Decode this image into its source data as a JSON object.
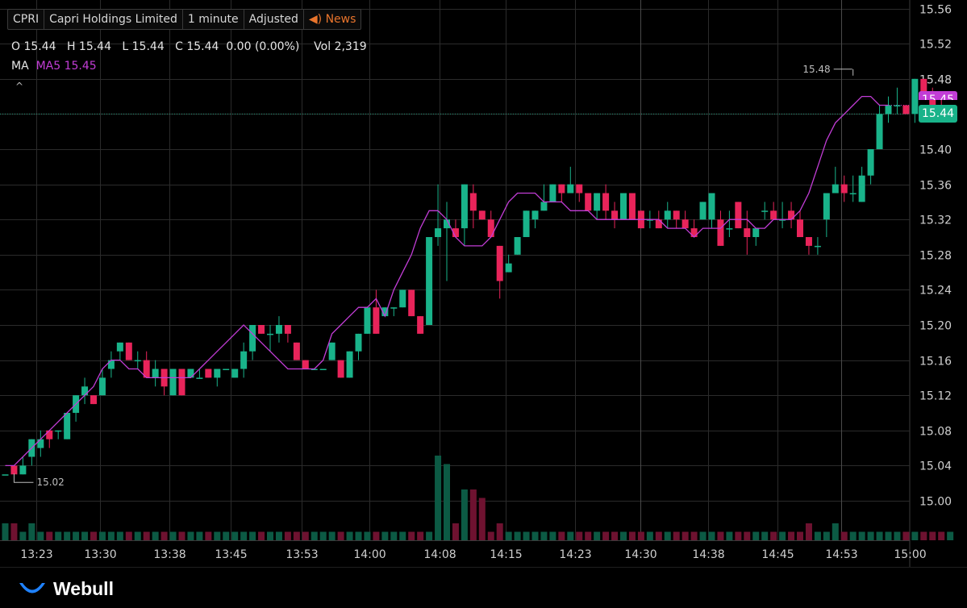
{
  "header": {
    "symbol": "CPRI",
    "company": "Capri Holdings Limited",
    "interval": "1 minute",
    "adjust": "Adjusted",
    "news": "News",
    "news_icon": "speaker-icon"
  },
  "ohlc": {
    "o_label": "O",
    "o": "15.44",
    "h_label": "H",
    "h": "15.44",
    "l_label": "L",
    "l": "15.44",
    "c_label": "C",
    "c": "15.44",
    "change": "0.00 (0.00%)",
    "vol_label": "Vol",
    "vol": "2,319"
  },
  "ma": {
    "label": "MA",
    "value": "MA5 15.45",
    "color": "#c23dd6"
  },
  "collapse_icon": "chevron-up-icon",
  "brand": {
    "name": "Webull",
    "icon": "webull-logo-icon"
  },
  "colors": {
    "up": "#19b38a",
    "down": "#e8245a",
    "ma": "#c23dd6",
    "background": "#000000",
    "grid": "#2b2b2b"
  },
  "last_price": {
    "value": "15.44",
    "ma_value": "15.45"
  },
  "chart_data": {
    "type": "candlestick",
    "ylim": [
      14.98,
      15.57
    ],
    "y_ticks": [
      "15.56",
      "15.52",
      "15.48",
      "15.44",
      "15.40",
      "15.36",
      "15.32",
      "15.28",
      "15.24",
      "15.20",
      "15.16",
      "15.12",
      "15.08",
      "15.04",
      "15.00"
    ],
    "x_tick_labels": [
      "13:23",
      "13:30",
      "13:38",
      "13:45",
      "13:53",
      "14:00",
      "14:08",
      "14:15",
      "14:23",
      "14:30",
      "14:38",
      "14:45",
      "14:53",
      "15:00"
    ],
    "x_tick_index": [
      3.5,
      10.7,
      18.6,
      25.5,
      33.6,
      41.2,
      49.2,
      56.7,
      64.5,
      71.9,
      79.6,
      87.4,
      94.7,
      102.4
    ],
    "annotations": {
      "high": "15.48",
      "low": "15.02"
    },
    "series": [
      {
        "name": "MA5",
        "values": [
          15.04,
          15.04,
          15.05,
          15.06,
          15.07,
          15.08,
          15.09,
          15.1,
          15.11,
          15.12,
          15.13,
          15.15,
          15.16,
          15.16,
          15.15,
          15.15,
          15.14,
          15.14,
          15.14,
          15.14,
          15.14,
          15.14,
          15.15,
          15.16,
          15.17,
          15.18,
          15.19,
          15.2,
          15.19,
          15.18,
          15.17,
          15.16,
          15.15,
          15.15,
          15.15,
          15.15,
          15.16,
          15.19,
          15.2,
          15.21,
          15.22,
          15.22,
          15.23,
          15.21,
          15.24,
          15.26,
          15.28,
          15.31,
          15.33,
          15.33,
          15.32,
          15.3,
          15.29,
          15.29,
          15.29,
          15.3,
          15.32,
          15.34,
          15.35,
          15.35,
          15.35,
          15.34,
          15.34,
          15.34,
          15.33,
          15.33,
          15.33,
          15.32,
          15.32,
          15.32,
          15.32,
          15.32,
          15.32,
          15.32,
          15.32,
          15.31,
          15.31,
          15.31,
          15.3,
          15.31,
          15.31,
          15.31,
          15.32,
          15.32,
          15.32,
          15.31,
          15.31,
          15.32,
          15.32,
          15.32,
          15.33,
          15.35,
          15.38,
          15.41,
          15.43,
          15.44,
          15.45,
          15.46,
          15.46,
          15.45,
          15.45
        ]
      }
    ],
    "candles": [
      [
        15.03,
        15.03,
        15.03,
        15.03,
        2
      ],
      [
        15.04,
        15.04,
        15.03,
        15.03,
        2
      ],
      [
        15.03,
        15.05,
        15.03,
        15.04,
        1
      ],
      [
        15.05,
        15.07,
        15.04,
        15.07,
        2
      ],
      [
        15.06,
        15.08,
        15.05,
        15.07,
        1
      ],
      [
        15.08,
        15.08,
        15.06,
        15.07,
        1
      ],
      [
        15.08,
        15.08,
        15.07,
        15.08,
        1
      ],
      [
        15.07,
        15.1,
        15.07,
        15.1,
        1
      ],
      [
        15.1,
        15.12,
        15.09,
        15.12,
        1
      ],
      [
        15.12,
        15.14,
        15.11,
        15.13,
        1
      ],
      [
        15.12,
        15.12,
        15.11,
        15.11,
        1
      ],
      [
        15.12,
        15.15,
        15.12,
        15.14,
        1
      ],
      [
        15.15,
        15.17,
        15.14,
        15.16,
        1
      ],
      [
        15.17,
        15.18,
        15.16,
        15.18,
        1
      ],
      [
        15.18,
        15.18,
        15.16,
        15.16,
        1
      ],
      [
        15.16,
        15.17,
        15.15,
        15.16,
        1
      ],
      [
        15.16,
        15.17,
        15.14,
        15.14,
        1
      ],
      [
        15.14,
        15.16,
        15.13,
        15.15,
        1
      ],
      [
        15.15,
        15.15,
        15.12,
        15.13,
        1
      ],
      [
        15.12,
        15.15,
        15.12,
        15.15,
        1
      ],
      [
        15.15,
        15.15,
        15.12,
        15.12,
        1
      ],
      [
        15.14,
        15.15,
        15.14,
        15.15,
        1
      ],
      [
        15.14,
        15.15,
        15.14,
        15.14,
        1
      ],
      [
        15.15,
        15.15,
        15.14,
        15.14,
        1
      ],
      [
        15.14,
        15.15,
        15.13,
        15.15,
        1
      ],
      [
        15.15,
        15.15,
        15.15,
        15.15,
        1
      ],
      [
        15.14,
        15.15,
        15.14,
        15.15,
        1
      ],
      [
        15.15,
        15.18,
        15.14,
        15.17,
        1
      ],
      [
        15.17,
        15.2,
        15.16,
        15.2,
        1
      ],
      [
        15.2,
        15.2,
        15.19,
        15.19,
        1
      ],
      [
        15.19,
        15.2,
        15.17,
        15.19,
        1
      ],
      [
        15.19,
        15.21,
        15.18,
        15.2,
        1
      ],
      [
        15.2,
        15.2,
        15.18,
        15.19,
        1
      ],
      [
        15.18,
        15.18,
        15.16,
        15.16,
        1
      ],
      [
        15.16,
        15.16,
        15.15,
        15.15,
        1
      ],
      [
        15.15,
        15.15,
        15.15,
        15.15,
        1
      ],
      [
        15.15,
        15.15,
        15.15,
        15.15,
        1
      ],
      [
        15.16,
        15.18,
        15.16,
        15.18,
        1
      ],
      [
        15.16,
        15.16,
        15.14,
        15.14,
        1
      ],
      [
        15.14,
        15.17,
        15.14,
        15.17,
        1
      ],
      [
        15.17,
        15.19,
        15.16,
        15.19,
        1
      ],
      [
        15.19,
        15.22,
        15.19,
        15.22,
        1
      ],
      [
        15.22,
        15.24,
        15.19,
        15.19,
        1
      ],
      [
        15.21,
        15.22,
        15.21,
        15.22,
        1
      ],
      [
        15.22,
        15.22,
        15.21,
        15.22,
        1
      ],
      [
        15.22,
        15.24,
        15.22,
        15.24,
        1
      ],
      [
        15.24,
        15.24,
        15.21,
        15.21,
        1
      ],
      [
        15.21,
        15.21,
        15.19,
        15.19,
        1
      ],
      [
        15.2,
        15.3,
        15.2,
        15.3,
        1
      ],
      [
        15.3,
        15.36,
        15.29,
        15.31,
        10
      ],
      [
        15.31,
        15.34,
        15.25,
        15.32,
        9
      ],
      [
        15.31,
        15.32,
        15.3,
        15.3,
        2
      ],
      [
        15.31,
        15.36,
        15.29,
        15.36,
        6
      ],
      [
        15.35,
        15.36,
        15.31,
        15.33,
        6
      ],
      [
        15.33,
        15.33,
        15.32,
        15.32,
        5
      ],
      [
        15.32,
        15.33,
        15.3,
        15.3,
        1
      ],
      [
        15.29,
        15.29,
        15.23,
        15.25,
        2
      ],
      [
        15.26,
        15.28,
        15.26,
        15.27,
        1
      ],
      [
        15.28,
        15.3,
        15.28,
        15.3,
        1
      ],
      [
        15.3,
        15.33,
        15.3,
        15.33,
        1
      ],
      [
        15.32,
        15.33,
        15.31,
        15.33,
        1
      ],
      [
        15.33,
        15.36,
        15.33,
        15.34,
        1
      ],
      [
        15.34,
        15.36,
        15.34,
        15.36,
        1
      ],
      [
        15.36,
        15.36,
        15.34,
        15.35,
        1
      ],
      [
        15.35,
        15.38,
        15.35,
        15.36,
        1
      ],
      [
        15.36,
        15.36,
        15.34,
        15.35,
        1
      ],
      [
        15.35,
        15.35,
        15.33,
        15.33,
        1
      ],
      [
        15.33,
        15.35,
        15.32,
        15.35,
        1
      ],
      [
        15.35,
        15.36,
        15.32,
        15.33,
        1
      ],
      [
        15.33,
        15.34,
        15.31,
        15.32,
        1
      ],
      [
        15.32,
        15.35,
        15.32,
        15.35,
        1
      ],
      [
        15.35,
        15.35,
        15.32,
        15.32,
        1
      ],
      [
        15.33,
        15.33,
        15.31,
        15.31,
        1
      ],
      [
        15.32,
        15.33,
        15.31,
        15.32,
        1
      ],
      [
        15.32,
        15.33,
        15.31,
        15.31,
        1
      ],
      [
        15.32,
        15.34,
        15.31,
        15.33,
        1
      ],
      [
        15.33,
        15.33,
        15.31,
        15.32,
        1
      ],
      [
        15.32,
        15.33,
        15.31,
        15.31,
        1
      ],
      [
        15.31,
        15.32,
        15.3,
        15.3,
        1
      ],
      [
        15.32,
        15.34,
        15.32,
        15.34,
        1
      ],
      [
        15.32,
        15.35,
        15.31,
        15.35,
        1
      ],
      [
        15.32,
        15.33,
        15.29,
        15.29,
        1
      ],
      [
        15.31,
        15.33,
        15.3,
        15.31,
        1
      ],
      [
        15.34,
        15.34,
        15.31,
        15.31,
        1
      ],
      [
        15.31,
        15.33,
        15.28,
        15.3,
        1
      ],
      [
        15.3,
        15.31,
        15.29,
        15.31,
        1
      ],
      [
        15.33,
        15.34,
        15.32,
        15.33,
        1
      ],
      [
        15.33,
        15.34,
        15.32,
        15.32,
        1
      ],
      [
        15.32,
        15.34,
        15.31,
        15.32,
        1
      ],
      [
        15.33,
        15.34,
        15.31,
        15.32,
        1
      ],
      [
        15.32,
        15.33,
        15.3,
        15.3,
        1
      ],
      [
        15.3,
        15.3,
        15.28,
        15.29,
        2
      ],
      [
        15.29,
        15.3,
        15.28,
        15.29,
        1
      ],
      [
        15.32,
        15.35,
        15.3,
        15.35,
        1
      ],
      [
        15.35,
        15.38,
        15.35,
        15.36,
        2
      ],
      [
        15.36,
        15.37,
        15.34,
        15.35,
        1
      ],
      [
        15.35,
        15.37,
        15.34,
        15.35,
        1
      ],
      [
        15.34,
        15.38,
        15.34,
        15.37,
        1
      ],
      [
        15.37,
        15.4,
        15.36,
        15.4,
        1
      ],
      [
        15.4,
        15.45,
        15.4,
        15.44,
        1
      ],
      [
        15.44,
        15.46,
        15.43,
        15.45,
        1
      ],
      [
        15.45,
        15.47,
        15.44,
        15.45,
        1
      ],
      [
        15.45,
        15.45,
        15.44,
        15.44,
        1
      ],
      [
        15.44,
        15.48,
        15.43,
        15.48,
        1
      ],
      [
        15.48,
        15.48,
        15.46,
        15.46,
        1
      ],
      [
        15.46,
        15.47,
        15.45,
        15.45,
        1
      ],
      [
        15.45,
        15.46,
        15.44,
        15.44,
        1
      ],
      [
        15.44,
        15.44,
        15.44,
        15.44,
        1
      ]
    ]
  }
}
